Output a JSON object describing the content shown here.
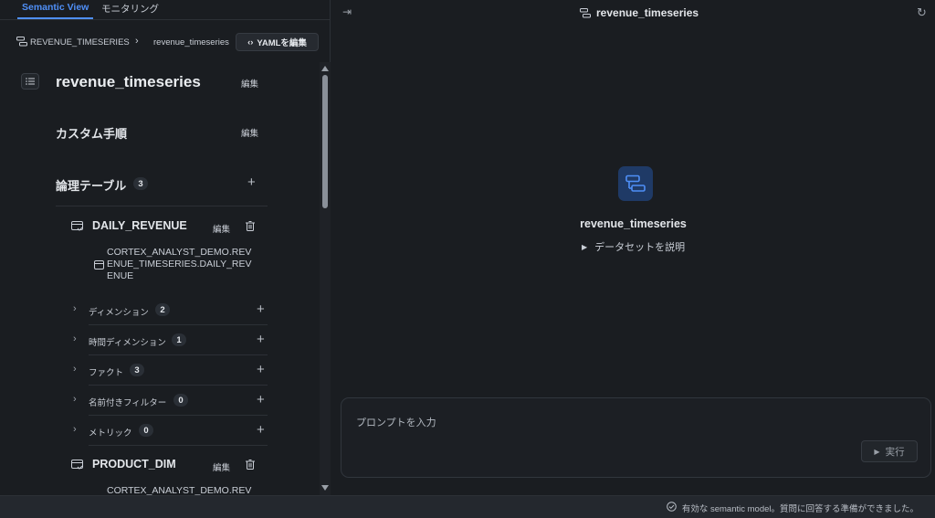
{
  "tabs": [
    {
      "label": "Semantic View"
    },
    {
      "label": "モニタリング"
    }
  ],
  "breadcrumb": {
    "root": "REVENUE_TIMESERIES",
    "leaf": "revenue_timeseries",
    "yaml_button": "YAMLを編集"
  },
  "model": {
    "name": "revenue_timeseries",
    "edit": "編集"
  },
  "custom_instructions": {
    "label": "カスタム手順",
    "edit": "編集"
  },
  "logical_tables": {
    "label": "論理テーブル",
    "count": "3",
    "tables": [
      {
        "name": "DAILY_REVENUE",
        "edit": "編集",
        "source_lines": [
          "CORTEX_ANALYST_DEMO.REV",
          "ENUE_TIMESERIES.DAILY_REV",
          "ENUE"
        ],
        "sections": [
          {
            "label": "ディメンション",
            "count": "2"
          },
          {
            "label": "時間ディメンション",
            "count": "1"
          },
          {
            "label": "ファクト",
            "count": "3"
          },
          {
            "label": "名前付きフィルター",
            "count": "0"
          },
          {
            "label": "メトリック",
            "count": "0"
          }
        ]
      },
      {
        "name": "PRODUCT_DIM",
        "edit": "編集",
        "source_lines": [
          "CORTEX_ANALYST_DEMO.REV"
        ]
      }
    ]
  },
  "right_panel": {
    "header_title": "revenue_timeseries",
    "center_title": "revenue_timeseries",
    "describe_label": "データセットを説明",
    "prompt_placeholder": "プロンプトを入力",
    "run_label": "実行"
  },
  "status": {
    "text": "有効な semantic model。質問に回答する準備ができました。"
  },
  "colors": {
    "accent": "#4f8ff7",
    "icon_bg": "#1f3a66"
  }
}
